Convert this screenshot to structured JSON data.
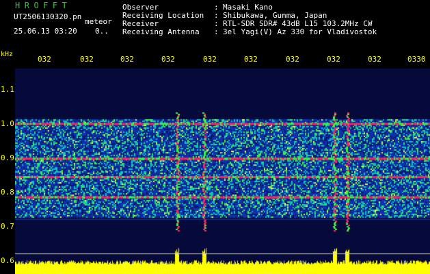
{
  "header": {
    "logo": "HROFFT",
    "filename": "UT2506130320.pn",
    "filename_suffix": "meteor",
    "datetime": "25.06.13 03:20",
    "counter": "0..",
    "rows": [
      {
        "label": "Observer",
        "value": "Masaki Kano"
      },
      {
        "label": "Receiving Location",
        "value": "Shibukawa, Gunma, Japan"
      },
      {
        "label": "Receiver",
        "value": "RTL-SDR SDR# 43dB L15 103.2MHz CW"
      },
      {
        "label": "Receiving Antenna",
        "value": "3el Yagi(V) Az 330 for Vladivostok"
      }
    ],
    "separator": ":"
  },
  "axes": {
    "y_unit": "kHz",
    "y_ticks": [
      "1.1",
      "1.0",
      "0.9",
      "0.8",
      "0.7",
      "0.6"
    ],
    "x_ticks": [
      "032",
      "032",
      "032",
      "032",
      "032",
      "032",
      "032",
      "032",
      "032",
      "0330"
    ]
  },
  "spectrogram": {
    "y_range_khz": [
      0.6,
      1.16
    ],
    "band_floor_khz": 0.755,
    "band_ceil_khz": 1.02,
    "strong_lines_khz": [
      1.01,
      0.915,
      0.865,
      0.81
    ],
    "vertical_bursts_x_frac": [
      0.39,
      0.455,
      0.77,
      0.8
    ],
    "colors": {
      "background": "#050a3a",
      "low": "#1030b0",
      "mid": "#10c0c0",
      "high": "#40f040",
      "peak": "#ff2060",
      "baseline": "#ffff00"
    }
  }
}
